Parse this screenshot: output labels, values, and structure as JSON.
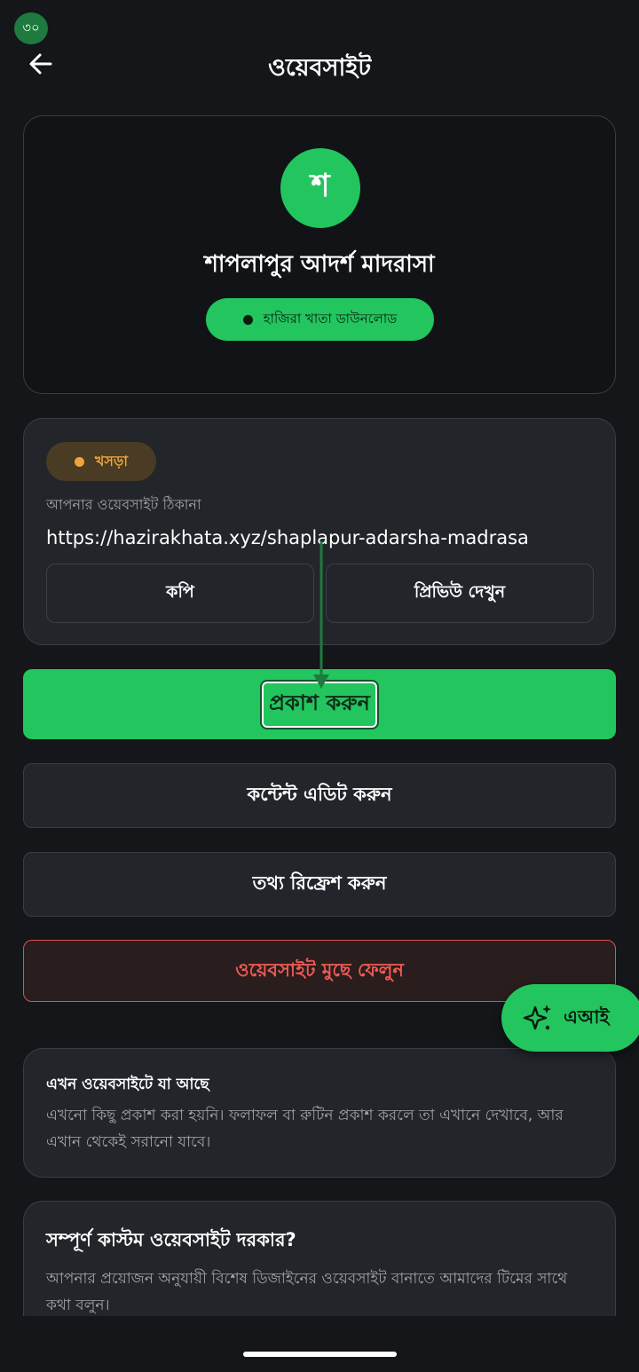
{
  "status": {
    "badge": "৩০"
  },
  "header": {
    "title": "ওয়েবসাইট",
    "back_icon": "arrow-left-icon"
  },
  "profile": {
    "avatar_letter": "শ",
    "name": "শাপলাপুর আদর্শ মাদরাসা",
    "pill_label": "হাজিরা খাতা ডাউনলোড"
  },
  "site": {
    "status_label": "খসড়া",
    "status_color": "#f0a43a",
    "address_label": "আপনার ওয়েবসাইট ঠিকানা",
    "url": "https://hazirakhata.xyz/shaplapur-adarsha-madrasa",
    "copy_label": "কপি",
    "preview_label": "প্রিভিউ দেখুন"
  },
  "actions": {
    "publish_label": "প্রকাশ করুন",
    "edit_label": "কন্টেন্ট এডিট করুন",
    "refresh_label": "তথ্য রিফ্রেশ করুন",
    "delete_label": "ওয়েবসাইট মুছে ফেলুন"
  },
  "ai": {
    "label": "এআই",
    "icon": "sparkle-icon"
  },
  "info": {
    "title": "এখন ওয়েবসাইটে যা আছে",
    "body": "এখনো কিছু প্রকাশ করা হয়নি। ফলাফল বা রুটিন প্রকাশ করলে তা এখানে দেখাবে, আর এখান থেকেই সরানো যাবে।"
  },
  "custom": {
    "title": "সম্পূর্ণ কাস্টম ওয়েবসাইট দরকার?",
    "body": "আপনার প্রয়োজন অনুযায়ী বিশেষ ডিজাইনের ওয়েবসাইট বানাতে আমাদের টিমের সাথে কথা বলুন।"
  },
  "colors": {
    "accent": "#22c55e",
    "danger": "#ef5a52",
    "background": "#141619"
  }
}
